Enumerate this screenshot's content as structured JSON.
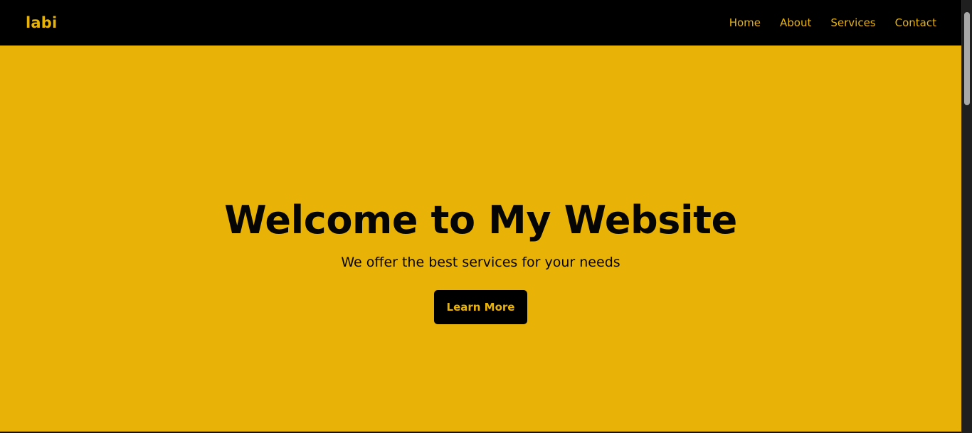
{
  "brand": {
    "name": "labi"
  },
  "navigation": {
    "items": [
      {
        "label": "Home"
      },
      {
        "label": "About"
      },
      {
        "label": "Services"
      },
      {
        "label": "Contact"
      }
    ]
  },
  "hero": {
    "title": "Welcome to My Website",
    "subtitle": "We offer the best services for your needs",
    "button_label": "Learn More"
  },
  "colors": {
    "accent": "#e8b306",
    "navbar_background": "#000000",
    "hero_text": "#050505",
    "scrollbar_track": "#1f1f1f",
    "scrollbar_thumb": "#a8a8a8"
  },
  "icons": {
    "scrollbar": "vertical-scrollbar-thumb"
  }
}
